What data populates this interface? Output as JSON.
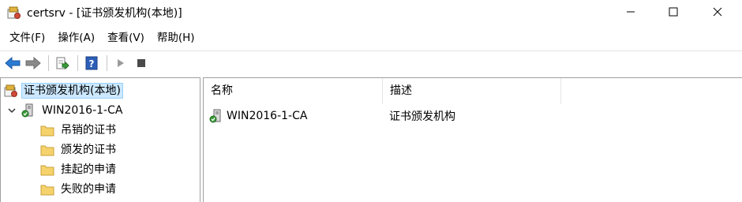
{
  "window": {
    "title": "certsrv - [证书颁发机构(本地)]"
  },
  "menu": [
    "文件(F)",
    "操作(A)",
    "查看(V)",
    "帮助(H)"
  ],
  "toolbar": {
    "buttons": [
      "back-arrow-icon",
      "forward-arrow-icon",
      "export-list-icon",
      "help-icon",
      "start-service-icon",
      "stop-service-icon"
    ]
  },
  "tree": {
    "root": "证书颁发机构(本地)",
    "ca": "WIN2016-1-CA",
    "folders": [
      "吊销的证书",
      "颁发的证书",
      "挂起的申请",
      "失败的申请"
    ]
  },
  "list": {
    "columns": [
      "名称",
      "描述"
    ],
    "rows": [
      {
        "name": "WIN2016-1-CA",
        "desc": "证书颁发机构"
      }
    ]
  },
  "colors": {
    "selection_bg": "#cce8ff",
    "selection_border": "#99d1ff",
    "folder": "#f5d26b",
    "arrow_blue": "#2b7bd3",
    "ca_green": "#3a9a3a"
  }
}
